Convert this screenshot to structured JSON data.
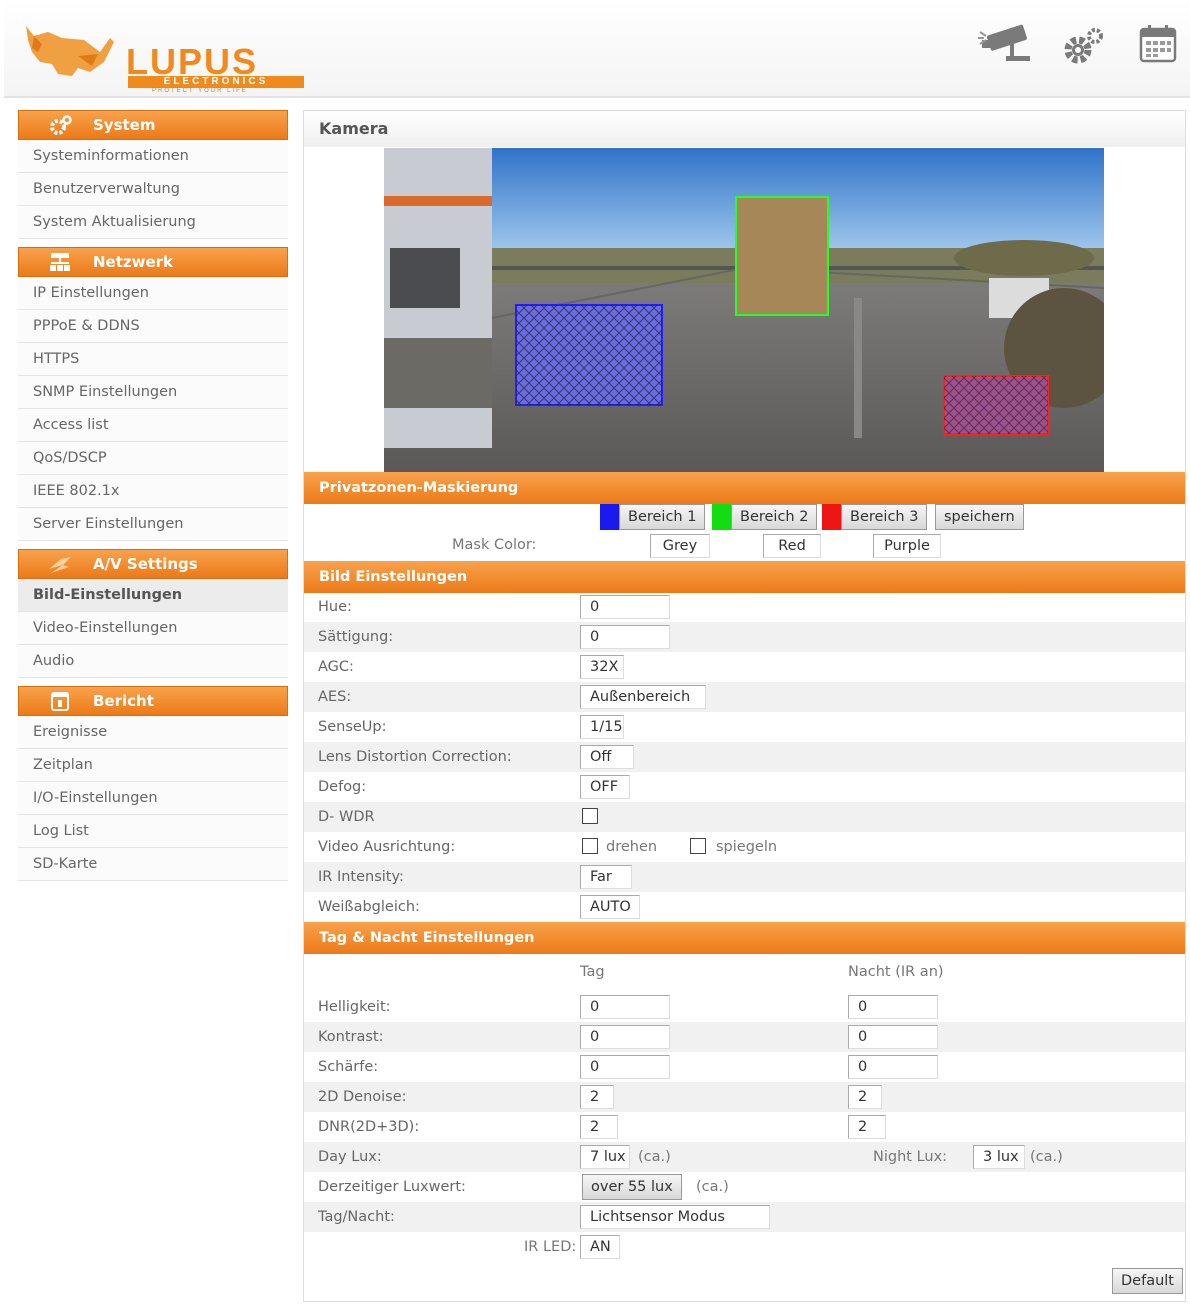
{
  "brand": {
    "name": "LUPUS",
    "sub": "ELECTRONICS",
    "tagline": "PROTECT YOUR LIFE"
  },
  "header_icons": [
    "camera-icon",
    "gear-icon",
    "calendar-icon"
  ],
  "sidebar": {
    "sections": [
      {
        "title": "System",
        "icon": "gear-icon",
        "items": [
          "Systeminformationen",
          "Benutzerverwaltung",
          "System Aktualisierung"
        ]
      },
      {
        "title": "Netzwerk",
        "icon": "network-icon",
        "items": [
          "IP Einstellungen",
          "PPPoE & DDNS",
          "HTTPS",
          "SNMP Einstellungen",
          "Access list",
          "QoS/DSCP",
          "IEEE 802.1x",
          "Server Einstellungen"
        ]
      },
      {
        "title": "A/V Settings",
        "icon": "av-icon",
        "items": [
          "Bild-Einstellungen",
          "Video-Einstellungen",
          "Audio"
        ]
      },
      {
        "title": "Bericht",
        "icon": "report-icon",
        "items": [
          "Ereignisse",
          "Zeitplan",
          "I/O-Einstellungen",
          "Log List",
          "SD-Karte"
        ]
      }
    ],
    "active_item": "Bild-Einstellungen"
  },
  "content": {
    "title": "Kamera",
    "privacy": {
      "heading": "Privatzonen-Maskierung",
      "areas": [
        {
          "label": "Bereich 1",
          "swatch": "#1a1aee"
        },
        {
          "label": "Bereich 2",
          "swatch": "#12dd12"
        },
        {
          "label": "Bereich 3",
          "swatch": "#ee1515"
        }
      ],
      "save_label": "speichern",
      "mask_color_label": "Mask Color:",
      "mask_colors": [
        "Grey",
        "Red",
        "Purple"
      ]
    },
    "bild": {
      "heading": "Bild Einstellungen",
      "hue_label": "Hue:",
      "hue": "0",
      "saturation_label": "Sättigung:",
      "saturation": "0",
      "agc_label": "AGC:",
      "agc": "32X",
      "aes_label": "AES:",
      "aes": "Außenbereich",
      "senseup_label": "SenseUp:",
      "senseup": "1/15",
      "ldc_label": "Lens Distortion Correction:",
      "ldc": "Off",
      "defog_label": "Defog:",
      "defog": "OFF",
      "dwdr_label": "D- WDR",
      "orientation_label": "Video Ausrichtung:",
      "rotate_label": "drehen",
      "mirror_label": "spiegeln",
      "ir_label": "IR Intensity:",
      "ir": "Far",
      "wb_label": "Weißabgleich:",
      "wb": "AUTO"
    },
    "tagnacht": {
      "heading": "Tag & Nacht Einstellungen",
      "col_day": "Tag",
      "col_night": "Nacht (IR an)",
      "brightness_label": "Helligkeit:",
      "brightness_day": "0",
      "brightness_night": "0",
      "contrast_label": "Kontrast:",
      "contrast_day": "0",
      "contrast_night": "0",
      "sharpness_label": "Schärfe:",
      "sharpness_day": "0",
      "sharpness_night": "0",
      "denoise_label": "2D Denoise:",
      "denoise_day": "2",
      "denoise_night": "2",
      "dnr_label": "DNR(2D+3D):",
      "dnr_day": "2",
      "dnr_night": "2",
      "daylux_label": "Day Lux:",
      "daylux": "7 lux",
      "ca": "(ca.)",
      "nightlux_label": "Night Lux:",
      "nightlux": "3 lux",
      "currentlux_label": "Derzeitiger Luxwert:",
      "currentlux": "over 55 lux",
      "daynight_label": "Tag/Nacht:",
      "daynight": "Lichtsensor Modus",
      "irled_label": "IR LED:",
      "irled": "AN"
    },
    "default_label": "Default"
  }
}
